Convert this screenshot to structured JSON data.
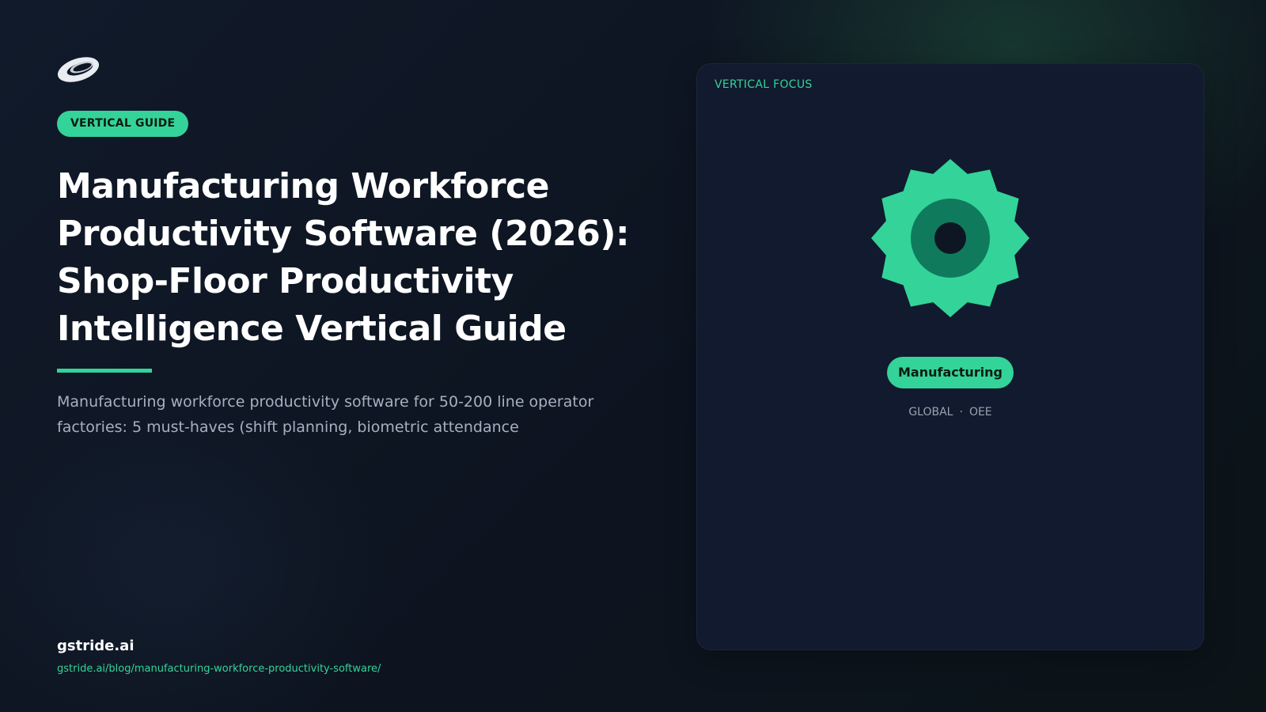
{
  "logo": {
    "icon": "swoosh-ring-icon"
  },
  "badge": "VERTICAL GUIDE",
  "title": "Manufacturing Workforce Productivity Software (2026): Shop-Floor Productivity Intelligence Vertical Guide",
  "subtitle": "Manufacturing workforce productivity software for 50-200 line operator factories: 5 must-haves (shift planning, biometric attendance",
  "footer": {
    "brand": "gstride.ai",
    "url": "gstride.ai/blog/manufacturing-workforce-productivity-software/"
  },
  "panel": {
    "label": "VERTICAL FOCUS",
    "icon": "gear-icon",
    "pill": "Manufacturing",
    "tags": [
      "GLOBAL",
      "OEE"
    ],
    "tag_separator": "·"
  },
  "colors": {
    "accent": "#34d399",
    "accent_dark": "#0f7b5c",
    "background": "#0f1623",
    "panel": "#111a2e"
  }
}
